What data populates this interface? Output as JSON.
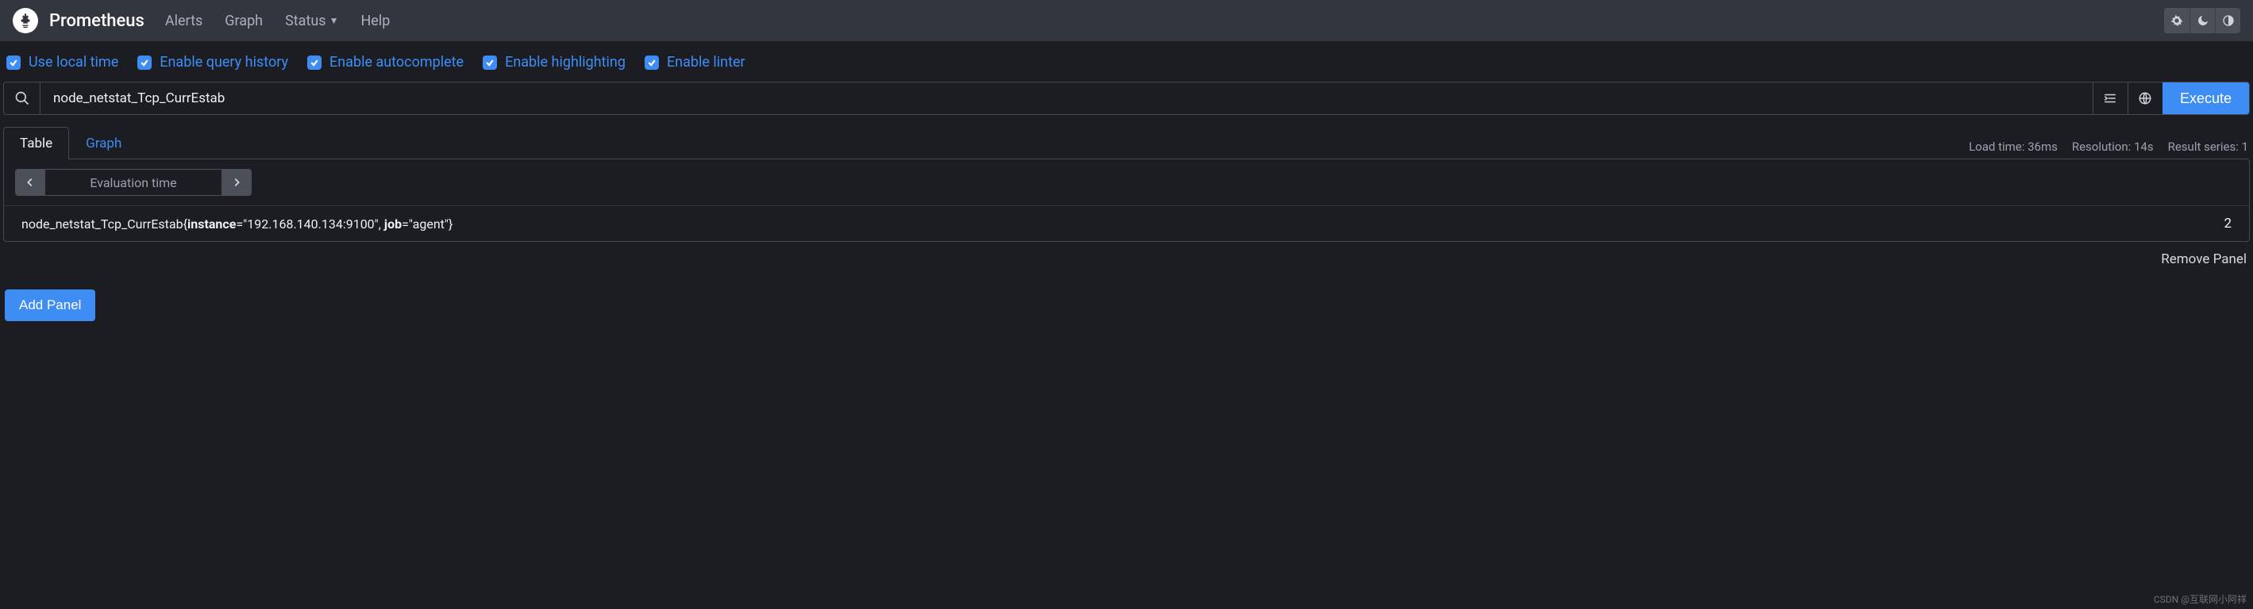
{
  "nav": {
    "brand": "Prometheus",
    "links": [
      "Alerts",
      "Graph",
      "Status",
      "Help"
    ]
  },
  "options": [
    {
      "label": "Use local time",
      "checked": true
    },
    {
      "label": "Enable query history",
      "checked": true
    },
    {
      "label": "Enable autocomplete",
      "checked": true
    },
    {
      "label": "Enable highlighting",
      "checked": true
    },
    {
      "label": "Enable linter",
      "checked": true
    }
  ],
  "query": {
    "expression": "node_netstat_Tcp_CurrEstab",
    "execute_label": "Execute"
  },
  "tabs": {
    "table": "Table",
    "graph": "Graph",
    "active": "table"
  },
  "stats": {
    "load_time": "Load time: 36ms",
    "resolution": "Resolution: 14s",
    "result_series": "Result series: 1"
  },
  "evaluation": {
    "label": "Evaluation time"
  },
  "result": {
    "metric_name": "node_netstat_Tcp_CurrEstab",
    "labels": [
      {
        "key": "instance",
        "value": "192.168.140.134:9100"
      },
      {
        "key": "job",
        "value": "agent"
      }
    ],
    "value": "2"
  },
  "actions": {
    "remove_panel": "Remove Panel",
    "add_panel": "Add Panel"
  },
  "watermark": "CSDN @互联网小阿祥"
}
